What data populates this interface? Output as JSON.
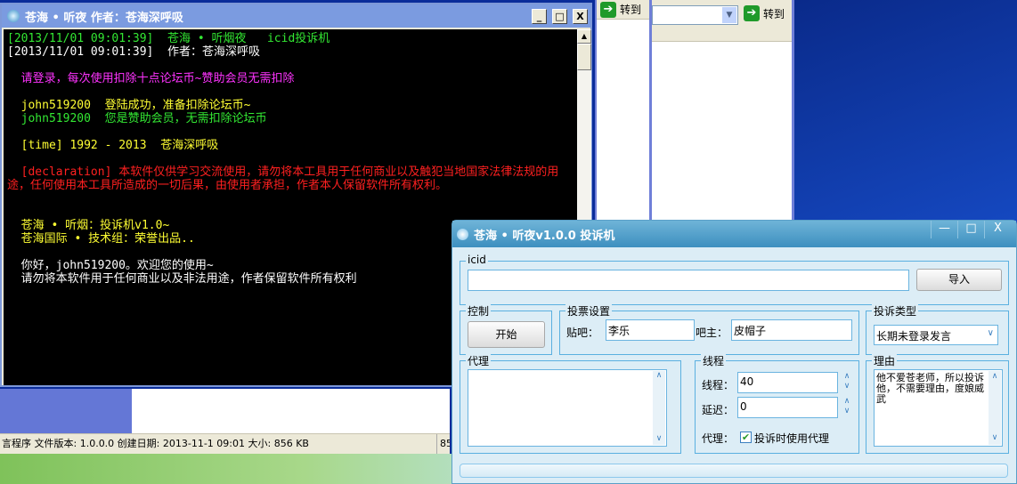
{
  "console": {
    "title": "苍海 • 听夜    作者：苍海深呼吸",
    "lines": [
      {
        "text": "[2013/11/01 09:01:39]  苍海 • 听烟夜   icid投诉机",
        "color": "#33e833"
      },
      {
        "text": "[2013/11/01 09:01:39]  作者：苍海深呼吸",
        "color": "#ffffff"
      },
      {
        "text": "",
        "color": "#fff"
      },
      {
        "text": "  请登录，每次使用扣除十点论坛币~赞助会员无需扣除",
        "color": "#ff33ff"
      },
      {
        "text": "",
        "color": "#fff"
      },
      {
        "text": "  john519200  登陆成功，准备扣除论坛币~",
        "color": "#ffff33"
      },
      {
        "text": "  john519200  您是赞助会员，无需扣除论坛币",
        "color": "#33e833"
      },
      {
        "text": "",
        "color": "#fff"
      },
      {
        "text": "  [time] 1992 - 2013  苍海深呼吸",
        "color": "#ffff33"
      },
      {
        "text": "",
        "color": "#fff"
      },
      {
        "text": "  [declaration] 本软件仅供学习交流使用，请勿将本工具用于任何商业以及触犯当地国家法律法规的用途，任何使用本工具所造成的一切后果，由使用者承担，作者本人保留软件所有权利。",
        "color": "#ff2020"
      },
      {
        "text": "",
        "color": "#fff"
      },
      {
        "text": "",
        "color": "#fff"
      },
      {
        "text": "  苍海 • 听烟：投诉机v1.0~",
        "color": "#ffff33"
      },
      {
        "text": "  苍海国际 • 技术组：荣誉出品..",
        "color": "#ffff33"
      },
      {
        "text": "",
        "color": "#fff"
      },
      {
        "text": "  你好，john519200。欢迎您的使用~",
        "color": "#ffffff"
      },
      {
        "text": "  请勿将本软件用于任何商业以及非法用途，作者保留软件所有权利",
        "color": "#ffffff"
      }
    ]
  },
  "bg": {
    "goto_label": "转到",
    "status_text": "言程序 文件版本: 1.0.0.0 创建日期: 2013-11-1 09:01 大小: 856 KB",
    "status_right": "85"
  },
  "dialog": {
    "title": "苍海 • 听夜v1.0.0   投诉机",
    "icid": {
      "legend": "icid",
      "value": "",
      "import_label": "导入"
    },
    "control": {
      "legend": "控制",
      "start_label": "开始"
    },
    "vote": {
      "legend": "投票设置",
      "tieba_label": "贴吧：",
      "tieba_value": "李乐",
      "owner_label": "吧主：",
      "owner_value": "皮帽子"
    },
    "complaint_type": {
      "legend": "投诉类型",
      "selected": "长期未登录发言"
    },
    "proxy": {
      "legend": "代理",
      "value": ""
    },
    "threads": {
      "legend": "线程",
      "threads_label": "线程：",
      "threads_value": "40",
      "delay_label": "延迟：",
      "delay_value": "0",
      "proxy_label": "代理：",
      "use_proxy_label": "投诉时使用代理",
      "use_proxy_checked": true
    },
    "reason": {
      "legend": "理由",
      "value": "他不爱苍老师，所以投诉他，不需要理由，度娘威武"
    },
    "progress": 0
  }
}
